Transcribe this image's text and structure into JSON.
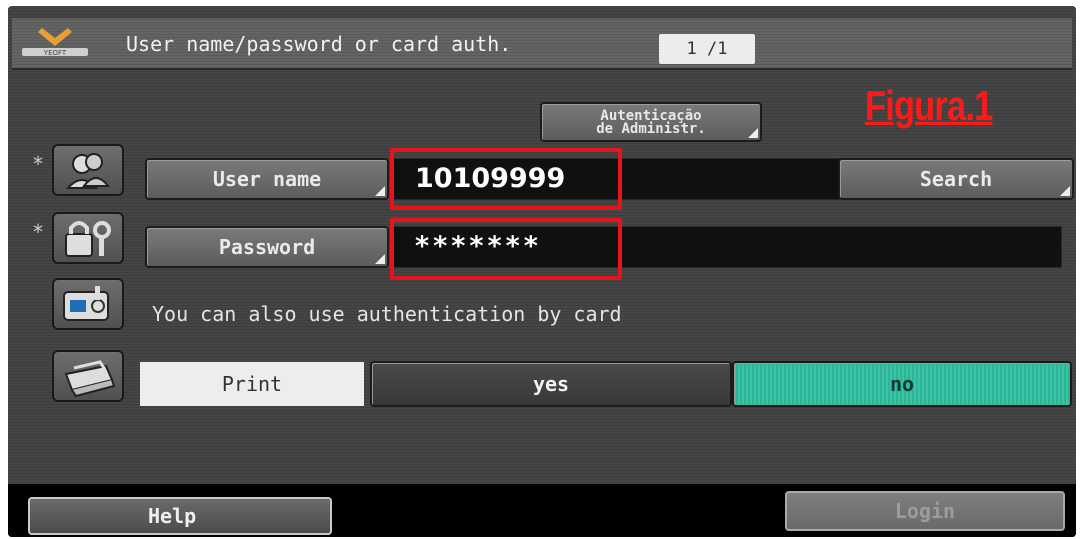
{
  "header": {
    "title": "User name/password or card auth.",
    "page_indicator": "1 /1"
  },
  "figure_label": "Figura.1",
  "admin_button": {
    "line1": "Autenticação",
    "line2": "de Administr."
  },
  "auth": {
    "user_name_label": "User name",
    "user_name_value": "10109999",
    "search_label": "Search",
    "password_label": "Password",
    "password_value": "*******",
    "card_message": "You can also use authentication by card"
  },
  "print_option": {
    "label": "Print",
    "options": [
      "yes",
      "no"
    ],
    "selected": "no"
  },
  "footer": {
    "help_label": "Help",
    "login_label": "Login"
  },
  "required_marker": "*",
  "colors": {
    "highlight": "#e8131b",
    "selected_option": "#39c2a4"
  },
  "icons": [
    "logo-icon",
    "users-icon",
    "lock-key-icon",
    "card-reader-icon",
    "printer-icon"
  ]
}
